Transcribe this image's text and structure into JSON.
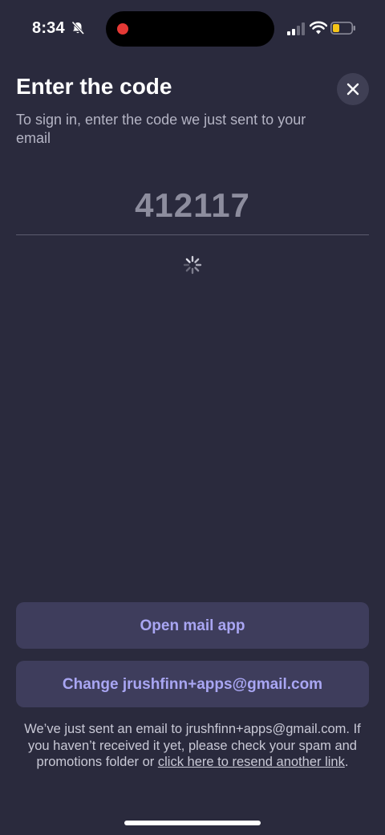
{
  "status_bar": {
    "time": "8:34",
    "icons": [
      "bell-slash-icon",
      "recording-dot-icon",
      "cellular-signal-icon",
      "wifi-icon",
      "battery-low-icon"
    ],
    "battery_color": "#f5c518",
    "recording_color": "#e53935"
  },
  "header": {
    "title": "Enter the code",
    "subtitle": "To sign in, enter the code we just sent to your email",
    "close_icon": "close-icon"
  },
  "code_input": {
    "value": "412117"
  },
  "loading": {
    "icon": "spinner-icon"
  },
  "buttons": {
    "open_mail": "Open mail app",
    "change_email": "Change jrushfinn+apps@gmail.com"
  },
  "footer": {
    "note_text": "We’ve just sent an email to jrushfinn+apps@gmail.com. If you haven’t received it yet, please check your spam and promotions folder or ",
    "resend_link": "click here to resend another link",
    "note_end": "."
  },
  "colors": {
    "background": "#2a2a3d",
    "button_bg": "#3e3d5c",
    "button_text": "#a9a6f3"
  }
}
